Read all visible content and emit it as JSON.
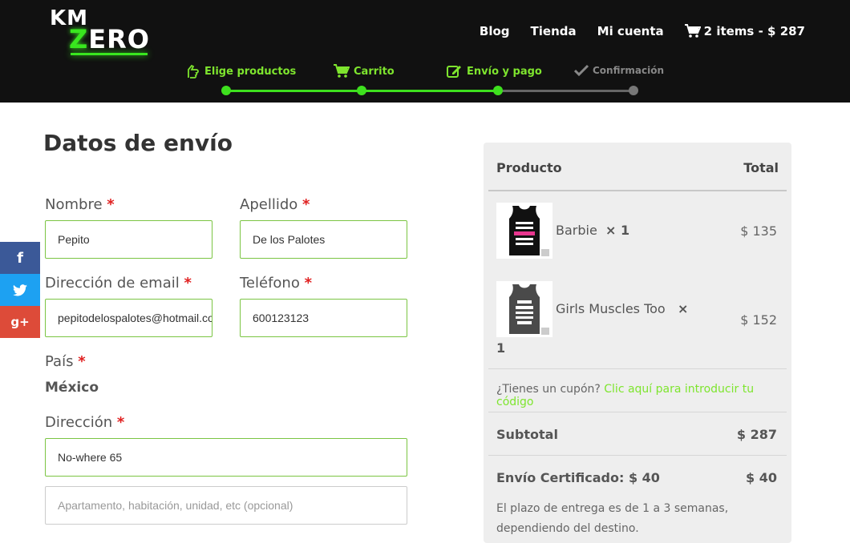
{
  "header": {
    "logo": {
      "km": "KM",
      "zero_z": "Z",
      "zero_rest": "ERO"
    },
    "nav": {
      "blog": "Blog",
      "tienda": "Tienda",
      "mi_cuenta": "Mi cuenta",
      "cart": "2 items -  $ 287"
    },
    "steps": [
      {
        "label": "Elige productos",
        "icon": "pointing-hand-icon",
        "state": "completed"
      },
      {
        "label": "Carrito",
        "icon": "cart-icon",
        "state": "completed"
      },
      {
        "label": "Envío y pago",
        "icon": "edit-icon",
        "state": "active"
      },
      {
        "label": "Confirmación",
        "icon": "check-icon",
        "state": "pending"
      }
    ]
  },
  "social": [
    {
      "label": "f",
      "icon": "facebook-icon",
      "color": "#3b5998"
    },
    {
      "label": "t",
      "icon": "twitter-icon",
      "color": "#1da1f2"
    },
    {
      "label": "g+",
      "icon": "google-plus-icon",
      "color": "#dd4b39"
    }
  ],
  "form": {
    "title": "Datos de envío",
    "required_mark": "*",
    "nombre": {
      "label": "Nombre",
      "value": "Pepito"
    },
    "apellido": {
      "label": "Apellido",
      "value": "De los Palotes"
    },
    "email": {
      "label": "Dirección de email",
      "value": "pepitodelospalotes@hotmail.com"
    },
    "telefono": {
      "label": "Teléfono",
      "value": "600123123"
    },
    "pais": {
      "label": "País",
      "value": "México"
    },
    "direccion": {
      "label": "Dirección",
      "value": "No-where 65"
    },
    "apartamento": {
      "placeholder": "Apartamento, habitación, unidad, etc (opcional)"
    }
  },
  "summary": {
    "header_producto": "Producto",
    "header_total": "Total",
    "items": [
      {
        "name": "Barbie",
        "qty": "× 1",
        "price": "$ 135"
      },
      {
        "name": "Girls Muscles Too",
        "qty": "×",
        "qty_num": "1",
        "price": "$ 152"
      }
    ],
    "coupon_text": "¿Tienes un cupón?",
    "coupon_link": "Clic aquí para introducir tu código",
    "subtotal_label": "Subtotal",
    "subtotal_value": "$ 287",
    "shipping_label": "Envío Certificado:  $ 40",
    "shipping_value": "$ 40",
    "shipping_note": "El plazo de entrega es de 1 a 3 semanas, dependiendo del destino."
  },
  "colors": {
    "accent": "#3ee01e",
    "header_bg": "#111111",
    "required": "#e02020"
  }
}
